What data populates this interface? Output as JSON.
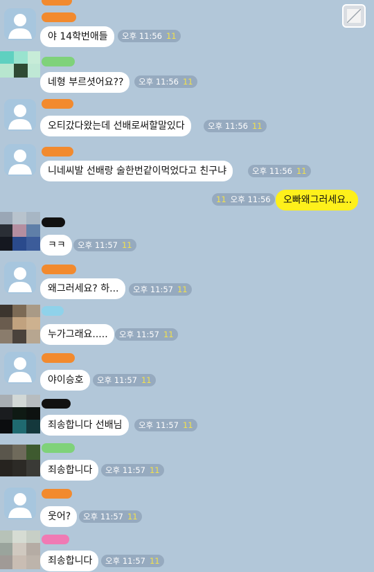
{
  "colors": {
    "background": "#b2c7d9",
    "my_bubble": "#fef01b",
    "other_bubble": "#ffffff",
    "unread": "#f4e24a"
  },
  "toolbar": {
    "expand_icon": "expand-icon"
  },
  "messages": [
    {
      "text": "야 14학번애들",
      "time": "오후 11:56",
      "unread": "11"
    },
    {
      "text": "네형 부르셧어요??",
      "time": "오후 11:56",
      "unread": "11"
    },
    {
      "text": "오티갔다왔는데 선배로써할말있다",
      "time": "오후 11:56",
      "unread": "11"
    },
    {
      "text": "니네씨발 선배랑 술한번같이먹었다고 친구냐",
      "time": "오후 11:56",
      "unread": "11"
    },
    {
      "text": "오빠왜그러세요..",
      "time": "오후 11:56",
      "unread": "11"
    },
    {
      "text": "ㅋㅋ",
      "time": "오후 11:57",
      "unread": "11"
    },
    {
      "text": "왜그러세요? 하...",
      "time": "오후 11:57",
      "unread": "11"
    },
    {
      "text": "누가그래요.....",
      "time": "오후 11:57",
      "unread": "11"
    },
    {
      "text": "야이승호",
      "time": "오후 11:57",
      "unread": "11"
    },
    {
      "text": "죄송합니다 선배님",
      "time": "오후 11:57",
      "unread": "11"
    },
    {
      "text": "죄송합니다",
      "time": "오후 11:57",
      "unread": "11"
    },
    {
      "text": "웃어?",
      "time": "오후 11:57",
      "unread": "11"
    },
    {
      "text": "죄송합니다",
      "time": "오후 11:57",
      "unread": "11"
    }
  ]
}
